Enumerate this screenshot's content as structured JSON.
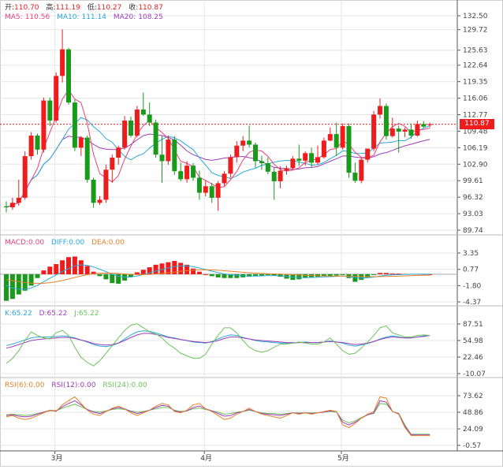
{
  "header": {
    "open_label": "开:",
    "open": "110.70",
    "high_label": "高:",
    "high": "111.19",
    "low_label": "低:",
    "low": "110.27",
    "close_label": "收:",
    "close": "110.87"
  },
  "ma_legend": {
    "ma5_label": "MA5:",
    "ma5": "110.56",
    "ma10_label": "MA10:",
    "ma10": "111.14",
    "ma20_label": "MA20:",
    "ma20": "108.25"
  },
  "macd_legend": {
    "macd": "MACD:0.00",
    "diff": "DIFF:0.00",
    "dea": "DEA:0.00"
  },
  "kdj_legend": {
    "k": "K:65.22",
    "d": "D:65.22",
    "j": "J:65.22"
  },
  "rsi_legend": {
    "rsi6": "RSI(6):0.00",
    "rsi12": "RSI(12):0.00",
    "rsi24": "RSI(24):0.00"
  },
  "last_price_tag": "110.87",
  "colors": {
    "up": "#ee1c1c",
    "down": "#1a9a1a",
    "ma5": "#e8437a",
    "ma10": "#29a9d6",
    "ma20": "#9b3fb8",
    "diff": "#29a9d6",
    "dea": "#e8812a",
    "k": "#29a9d6",
    "d": "#9b3fb8",
    "j": "#6cc35a",
    "rsi6": "#e8812a",
    "rsi12": "#9b3fb8",
    "rsi24": "#6cc35a",
    "grid": "#e6e6e6",
    "axis": "#555555"
  },
  "chart_data": [
    {
      "type": "candlestick",
      "panel": "main",
      "ylim": [
        89.74,
        132.5
      ],
      "y_ticks": [
        "132.50",
        "129.72",
        "125.63",
        "122.64",
        "119.35",
        "116.06",
        "112.77",
        "109.48",
        "106.19",
        "102.90",
        "99.61",
        "96.32",
        "93.03",
        "89.74"
      ],
      "x_ticks": [
        "3月",
        "4月",
        "5月"
      ],
      "x_tick_index": [
        4,
        28,
        50
      ],
      "last_price": 110.87,
      "ohlc": [
        [
          94.5,
          95.5,
          93.3,
          94.3
        ],
        [
          94.3,
          96.2,
          93.8,
          95.2
        ],
        [
          95.2,
          99.8,
          94.6,
          96.2
        ],
        [
          96.2,
          105.5,
          95.8,
          104.5
        ],
        [
          104.5,
          109.3,
          103.8,
          108.6
        ],
        [
          108.6,
          109.0,
          104.8,
          105.8
        ],
        [
          105.8,
          116.2,
          105.2,
          115.6
        ],
        [
          115.6,
          116.2,
          110.5,
          111.6
        ],
        [
          111.6,
          121.2,
          111.2,
          120.5
        ],
        [
          120.5,
          129.8,
          119.2,
          125.8
        ],
        [
          125.8,
          126.1,
          114.8,
          115.2
        ],
        [
          115.2,
          115.8,
          105.5,
          106.2
        ],
        [
          106.2,
          108.5,
          104.5,
          108.2
        ],
        [
          108.2,
          108.6,
          99.2,
          99.8
        ],
        [
          99.8,
          100.2,
          94.2,
          95.2
        ],
        [
          95.2,
          96.5,
          94.8,
          95.8
        ],
        [
          95.8,
          102.8,
          95.2,
          101.8
        ],
        [
          101.8,
          104.8,
          99.2,
          104.2
        ],
        [
          104.2,
          106.6,
          102.8,
          106.2
        ],
        [
          106.2,
          112.5,
          105.8,
          111.6
        ],
        [
          111.6,
          112.4,
          108.2,
          108.6
        ],
        [
          108.6,
          114.5,
          108.2,
          113.8
        ],
        [
          113.8,
          117.2,
          112.5,
          112.8
        ],
        [
          112.8,
          115.2,
          110.5,
          111.2
        ],
        [
          111.2,
          111.8,
          104.2,
          104.8
        ],
        [
          104.8,
          108.5,
          99.2,
          103.5
        ],
        [
          103.5,
          108.6,
          102.8,
          107.8
        ],
        [
          107.8,
          108.5,
          100.8,
          101.5
        ],
        [
          101.5,
          103.2,
          99.5,
          99.9
        ],
        [
          99.9,
          103.5,
          99.2,
          102.6
        ],
        [
          102.6,
          103.1,
          99.6,
          100.2
        ],
        [
          100.2,
          101.6,
          95.8,
          97.2
        ],
        [
          97.2,
          99.6,
          96.5,
          98.5
        ],
        [
          98.5,
          99.2,
          95.2,
          96.2
        ],
        [
          96.2,
          99.5,
          93.6,
          99.1
        ],
        [
          99.1,
          101.5,
          98.5,
          101.0
        ],
        [
          101.0,
          104.8,
          100.2,
          104.3
        ],
        [
          104.3,
          107.5,
          103.2,
          106.6
        ],
        [
          106.6,
          108.5,
          105.5,
          107.6
        ],
        [
          107.6,
          110.6,
          106.2,
          106.8
        ],
        [
          106.8,
          107.2,
          102.2,
          103.5
        ],
        [
          103.5,
          104.6,
          101.8,
          103.1
        ],
        [
          103.1,
          104.2,
          100.9,
          101.4
        ],
        [
          101.4,
          102.2,
          95.8,
          99.5
        ],
        [
          99.5,
          102.5,
          98.1,
          101.6
        ],
        [
          101.6,
          102.6,
          100.8,
          102.1
        ],
        [
          102.1,
          104.5,
          101.8,
          104.0
        ],
        [
          104.0,
          106.8,
          102.5,
          103.6
        ],
        [
          103.6,
          105.5,
          102.6,
          105.1
        ],
        [
          105.1,
          106.2,
          102.2,
          103.2
        ],
        [
          103.2,
          106.6,
          102.8,
          104.3
        ],
        [
          104.3,
          108.2,
          104.0,
          107.6
        ],
        [
          107.6,
          110.2,
          107.5,
          108.9
        ],
        [
          108.9,
          111.2,
          104.5,
          106.2
        ],
        [
          106.2,
          111.0,
          105.8,
          110.5
        ],
        [
          110.5,
          111.0,
          100.2,
          101.2
        ],
        [
          101.2,
          103.2,
          99.2,
          99.6
        ],
        [
          99.6,
          104.2,
          99.1,
          103.8
        ],
        [
          103.8,
          106.0,
          103.2,
          106.0
        ],
        [
          106.0,
          113.5,
          105.5,
          112.8
        ],
        [
          112.8,
          116.0,
          112.0,
          114.5
        ],
        [
          114.5,
          115.0,
          107.8,
          108.5
        ],
        [
          108.5,
          112.2,
          108.2,
          110.0
        ],
        [
          110.0,
          110.6,
          105.2,
          109.4
        ],
        [
          109.4,
          110.2,
          108.3,
          109.8
        ],
        [
          109.8,
          111.0,
          108.0,
          108.6
        ],
        [
          108.6,
          111.6,
          108.4,
          110.9
        ],
        [
          110.9,
          111.5,
          110.1,
          110.4
        ],
        [
          110.7,
          111.19,
          110.27,
          110.87
        ]
      ]
    },
    {
      "type": "bar",
      "panel": "macd",
      "ylim": [
        -4.37,
        3.35
      ],
      "y_ticks": [
        "3.35",
        "0.77",
        "-1.80",
        "-4.37"
      ],
      "series": [
        {
          "name": "MACD",
          "values": [
            -4.2,
            -3.9,
            -3.2,
            -2.6,
            -1.8,
            -0.6,
            0.6,
            1.2,
            1.6,
            2.2,
            2.7,
            2.8,
            2.2,
            1.3,
            0.4,
            -0.3,
            -0.8,
            -1.4,
            -1.5,
            -1.0,
            -0.4,
            0.3,
            0.7,
            1.1,
            1.5,
            1.7,
            1.9,
            2.1,
            1.8,
            1.5,
            0.9,
            0.4,
            0.0,
            -0.3,
            -0.5,
            -0.6,
            -0.6,
            -0.6,
            -0.5,
            -0.4,
            -0.3,
            -0.2,
            -0.1,
            -0.2,
            -0.4,
            -0.7,
            -0.9,
            -0.8,
            -0.6,
            -0.5,
            -0.4,
            -0.3,
            -0.3,
            -0.2,
            -0.1,
            -0.6,
            -1.2,
            -0.9,
            -0.5,
            -0.1,
            0.2,
            0.2,
            0.1,
            0.1,
            0.05,
            0.05,
            0.05,
            0.05,
            0.0
          ]
        }
      ]
    },
    {
      "type": "line",
      "panel": "kdj",
      "ylim": [
        -10.07,
        87.51
      ],
      "y_ticks": [
        "87.51",
        "54.98",
        "22.46",
        "-10.07"
      ],
      "series": [
        {
          "name": "K",
          "values": [
            45,
            48,
            52,
            56,
            60,
            62,
            62,
            62,
            63,
            64,
            63,
            60,
            56,
            52,
            47,
            44,
            43,
            45,
            50,
            58,
            66,
            72,
            74,
            73,
            70,
            66,
            62,
            60,
            57,
            55,
            52,
            51,
            50,
            53,
            58,
            63,
            66,
            65,
            61,
            58,
            55,
            53,
            52,
            51,
            50,
            50,
            50,
            51,
            52,
            51,
            51,
            52,
            54,
            52,
            50,
            46,
            44,
            46,
            49,
            53,
            58,
            62,
            64,
            62,
            60,
            60,
            62,
            64,
            65
          ]
        },
        {
          "name": "D",
          "values": [
            40,
            43,
            47,
            51,
            55,
            57,
            58,
            59,
            60,
            61,
            61,
            59,
            56,
            53,
            49,
            47,
            46,
            47,
            50,
            55,
            61,
            66,
            69,
            69,
            67,
            64,
            61,
            59,
            57,
            55,
            53,
            52,
            51,
            52,
            55,
            59,
            62,
            62,
            60,
            58,
            56,
            55,
            54,
            53,
            52,
            51,
            51,
            51,
            51,
            51,
            51,
            52,
            53,
            52,
            51,
            49,
            47,
            48,
            50,
            53,
            57,
            60,
            62,
            61,
            60,
            60,
            62,
            63,
            65
          ]
        },
        {
          "name": "J",
          "values": [
            10,
            20,
            35,
            55,
            72,
            65,
            60,
            58,
            70,
            75,
            65,
            42,
            22,
            12,
            5,
            15,
            30,
            45,
            60,
            75,
            85,
            88,
            80,
            72,
            68,
            60,
            48,
            40,
            30,
            25,
            20,
            20,
            28,
            48,
            65,
            80,
            80,
            70,
            55,
            42,
            35,
            32,
            35,
            42,
            48,
            48,
            50,
            52,
            50,
            48,
            48,
            52,
            60,
            48,
            35,
            28,
            30,
            40,
            52,
            65,
            80,
            84,
            70,
            66,
            62,
            62,
            65,
            66,
            65
          ]
        }
      ]
    },
    {
      "type": "line",
      "panel": "rsi",
      "ylim": [
        -0.57,
        73.62
      ],
      "y_ticks": [
        "73.62",
        "48.86",
        "24.09",
        "-0.57"
      ],
      "series": [
        {
          "name": "RSI(6)",
          "values": [
            42,
            44,
            40,
            38,
            40,
            44,
            48,
            52,
            50,
            60,
            66,
            72,
            62,
            52,
            46,
            44,
            50,
            55,
            58,
            54,
            48,
            44,
            48,
            52,
            58,
            62,
            60,
            50,
            48,
            52,
            60,
            62,
            54,
            50,
            44,
            38,
            40,
            46,
            50,
            55,
            50,
            46,
            44,
            42,
            40,
            44,
            48,
            46,
            48,
            46,
            48,
            50,
            52,
            50,
            30,
            26,
            32,
            40,
            46,
            50,
            72,
            70,
            50,
            46,
            26,
            14,
            14,
            14,
            14
          ]
        },
        {
          "name": "RSI(12)",
          "values": [
            44,
            45,
            43,
            42,
            43,
            46,
            49,
            52,
            51,
            57,
            62,
            66,
            60,
            53,
            49,
            47,
            50,
            54,
            56,
            54,
            50,
            47,
            49,
            52,
            56,
            59,
            58,
            51,
            49,
            51,
            56,
            58,
            54,
            51,
            47,
            43,
            44,
            48,
            50,
            53,
            50,
            47,
            46,
            45,
            44,
            46,
            48,
            47,
            48,
            47,
            48,
            49,
            51,
            50,
            34,
            30,
            34,
            40,
            45,
            48,
            66,
            64,
            50,
            47,
            28,
            15,
            15,
            15,
            15
          ]
        },
        {
          "name": "RSI(24)",
          "values": [
            45,
            46,
            45,
            44,
            45,
            47,
            49,
            51,
            51,
            55,
            58,
            61,
            57,
            53,
            50,
            49,
            51,
            53,
            54,
            53,
            51,
            49,
            50,
            52,
            54,
            56,
            56,
            52,
            50,
            51,
            54,
            55,
            53,
            51,
            49,
            46,
            47,
            49,
            50,
            52,
            50,
            48,
            47,
            47,
            46,
            47,
            48,
            48,
            48,
            48,
            48,
            49,
            50,
            49,
            37,
            33,
            36,
            41,
            45,
            47,
            62,
            61,
            50,
            47,
            30,
            16,
            16,
            16,
            16
          ]
        }
      ]
    }
  ]
}
